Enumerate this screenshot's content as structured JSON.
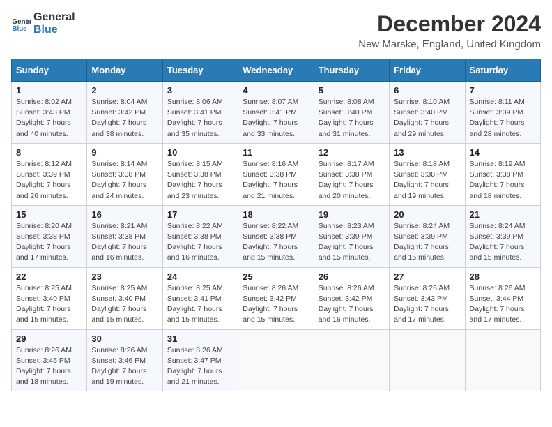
{
  "logo": {
    "general": "General",
    "blue": "Blue"
  },
  "title": "December 2024",
  "subtitle": "New Marske, England, United Kingdom",
  "calendar": {
    "headers": [
      "Sunday",
      "Monday",
      "Tuesday",
      "Wednesday",
      "Thursday",
      "Friday",
      "Saturday"
    ],
    "weeks": [
      [
        {
          "day": "1",
          "sunrise": "Sunrise: 8:02 AM",
          "sunset": "Sunset: 3:43 PM",
          "daylight": "Daylight: 7 hours and 40 minutes."
        },
        {
          "day": "2",
          "sunrise": "Sunrise: 8:04 AM",
          "sunset": "Sunset: 3:42 PM",
          "daylight": "Daylight: 7 hours and 38 minutes."
        },
        {
          "day": "3",
          "sunrise": "Sunrise: 8:06 AM",
          "sunset": "Sunset: 3:41 PM",
          "daylight": "Daylight: 7 hours and 35 minutes."
        },
        {
          "day": "4",
          "sunrise": "Sunrise: 8:07 AM",
          "sunset": "Sunset: 3:41 PM",
          "daylight": "Daylight: 7 hours and 33 minutes."
        },
        {
          "day": "5",
          "sunrise": "Sunrise: 8:08 AM",
          "sunset": "Sunset: 3:40 PM",
          "daylight": "Daylight: 7 hours and 31 minutes."
        },
        {
          "day": "6",
          "sunrise": "Sunrise: 8:10 AM",
          "sunset": "Sunset: 3:40 PM",
          "daylight": "Daylight: 7 hours and 29 minutes."
        },
        {
          "day": "7",
          "sunrise": "Sunrise: 8:11 AM",
          "sunset": "Sunset: 3:39 PM",
          "daylight": "Daylight: 7 hours and 28 minutes."
        }
      ],
      [
        {
          "day": "8",
          "sunrise": "Sunrise: 8:12 AM",
          "sunset": "Sunset: 3:39 PM",
          "daylight": "Daylight: 7 hours and 26 minutes."
        },
        {
          "day": "9",
          "sunrise": "Sunrise: 8:14 AM",
          "sunset": "Sunset: 3:38 PM",
          "daylight": "Daylight: 7 hours and 24 minutes."
        },
        {
          "day": "10",
          "sunrise": "Sunrise: 8:15 AM",
          "sunset": "Sunset: 3:38 PM",
          "daylight": "Daylight: 7 hours and 23 minutes."
        },
        {
          "day": "11",
          "sunrise": "Sunrise: 8:16 AM",
          "sunset": "Sunset: 3:38 PM",
          "daylight": "Daylight: 7 hours and 21 minutes."
        },
        {
          "day": "12",
          "sunrise": "Sunrise: 8:17 AM",
          "sunset": "Sunset: 3:38 PM",
          "daylight": "Daylight: 7 hours and 20 minutes."
        },
        {
          "day": "13",
          "sunrise": "Sunrise: 8:18 AM",
          "sunset": "Sunset: 3:38 PM",
          "daylight": "Daylight: 7 hours and 19 minutes."
        },
        {
          "day": "14",
          "sunrise": "Sunrise: 8:19 AM",
          "sunset": "Sunset: 3:38 PM",
          "daylight": "Daylight: 7 hours and 18 minutes."
        }
      ],
      [
        {
          "day": "15",
          "sunrise": "Sunrise: 8:20 AM",
          "sunset": "Sunset: 3:38 PM",
          "daylight": "Daylight: 7 hours and 17 minutes."
        },
        {
          "day": "16",
          "sunrise": "Sunrise: 8:21 AM",
          "sunset": "Sunset: 3:38 PM",
          "daylight": "Daylight: 7 hours and 16 minutes."
        },
        {
          "day": "17",
          "sunrise": "Sunrise: 8:22 AM",
          "sunset": "Sunset: 3:38 PM",
          "daylight": "Daylight: 7 hours and 16 minutes."
        },
        {
          "day": "18",
          "sunrise": "Sunrise: 8:22 AM",
          "sunset": "Sunset: 3:38 PM",
          "daylight": "Daylight: 7 hours and 15 minutes."
        },
        {
          "day": "19",
          "sunrise": "Sunrise: 8:23 AM",
          "sunset": "Sunset: 3:39 PM",
          "daylight": "Daylight: 7 hours and 15 minutes."
        },
        {
          "day": "20",
          "sunrise": "Sunrise: 8:24 AM",
          "sunset": "Sunset: 3:39 PM",
          "daylight": "Daylight: 7 hours and 15 minutes."
        },
        {
          "day": "21",
          "sunrise": "Sunrise: 8:24 AM",
          "sunset": "Sunset: 3:39 PM",
          "daylight": "Daylight: 7 hours and 15 minutes."
        }
      ],
      [
        {
          "day": "22",
          "sunrise": "Sunrise: 8:25 AM",
          "sunset": "Sunset: 3:40 PM",
          "daylight": "Daylight: 7 hours and 15 minutes."
        },
        {
          "day": "23",
          "sunrise": "Sunrise: 8:25 AM",
          "sunset": "Sunset: 3:40 PM",
          "daylight": "Daylight: 7 hours and 15 minutes."
        },
        {
          "day": "24",
          "sunrise": "Sunrise: 8:25 AM",
          "sunset": "Sunset: 3:41 PM",
          "daylight": "Daylight: 7 hours and 15 minutes."
        },
        {
          "day": "25",
          "sunrise": "Sunrise: 8:26 AM",
          "sunset": "Sunset: 3:42 PM",
          "daylight": "Daylight: 7 hours and 15 minutes."
        },
        {
          "day": "26",
          "sunrise": "Sunrise: 8:26 AM",
          "sunset": "Sunset: 3:42 PM",
          "daylight": "Daylight: 7 hours and 16 minutes."
        },
        {
          "day": "27",
          "sunrise": "Sunrise: 8:26 AM",
          "sunset": "Sunset: 3:43 PM",
          "daylight": "Daylight: 7 hours and 17 minutes."
        },
        {
          "day": "28",
          "sunrise": "Sunrise: 8:26 AM",
          "sunset": "Sunset: 3:44 PM",
          "daylight": "Daylight: 7 hours and 17 minutes."
        }
      ],
      [
        {
          "day": "29",
          "sunrise": "Sunrise: 8:26 AM",
          "sunset": "Sunset: 3:45 PM",
          "daylight": "Daylight: 7 hours and 18 minutes."
        },
        {
          "day": "30",
          "sunrise": "Sunrise: 8:26 AM",
          "sunset": "Sunset: 3:46 PM",
          "daylight": "Daylight: 7 hours and 19 minutes."
        },
        {
          "day": "31",
          "sunrise": "Sunrise: 8:26 AM",
          "sunset": "Sunset: 3:47 PM",
          "daylight": "Daylight: 7 hours and 21 minutes."
        },
        null,
        null,
        null,
        null
      ]
    ]
  }
}
